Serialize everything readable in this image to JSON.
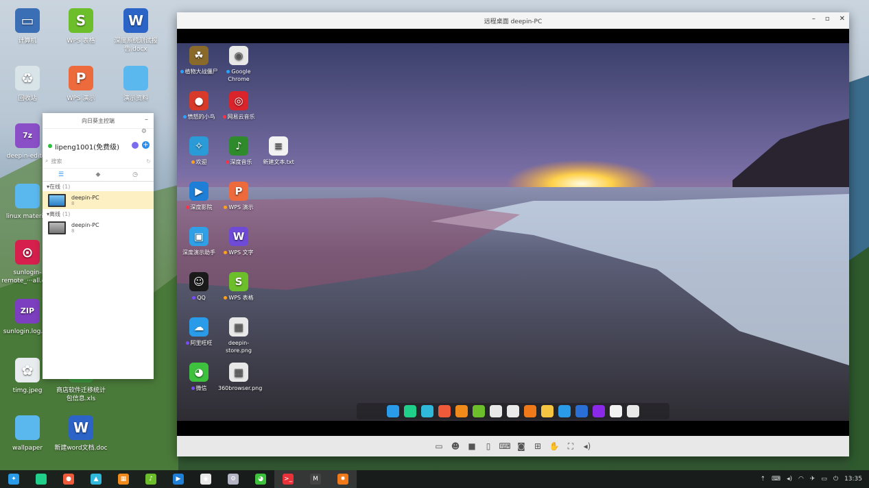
{
  "desktop_icons": [
    {
      "label": "计算机",
      "color": "#3b6fb5",
      "glyph": "▭"
    },
    {
      "label": "WPS 表格",
      "color": "#6cbf2a",
      "glyph": "S"
    },
    {
      "label": "深度系统测试报告.docx",
      "color": "#2b63c6",
      "glyph": "W"
    },
    {
      "label": "回收站",
      "color": "#d9e4e8",
      "glyph": "♻"
    },
    {
      "label": "WPS 演示",
      "color": "#ec6a3c",
      "glyph": "P"
    },
    {
      "label": "演示资料",
      "color": "#5bb8ee",
      "glyph": ""
    },
    {
      "label": "deepin-editor",
      "color": "#8a4fc7",
      "glyph": "7z"
    },
    {
      "label": "linux material",
      "color": "#5bb8ee",
      "glyph": ""
    },
    {
      "label": "sunlogin-remote_···all.deb",
      "color": "#d61f4d",
      "glyph": "⊙"
    },
    {
      "label": "sunlogin.log.zip",
      "color": "#7c3fbf",
      "glyph": "ZIP"
    },
    {
      "label": "timg.jpeg",
      "color": "#e8ecee",
      "glyph": "✿"
    },
    {
      "label": "商店软件迁移统计包信息.xls",
      "color": "#3d9a42",
      "glyph": "S"
    },
    {
      "label": "wallpaper",
      "color": "#5bb8ee",
      "glyph": ""
    },
    {
      "label": "新建word文档.doc",
      "color": "#2b63c6",
      "glyph": "W"
    }
  ],
  "remote_window": {
    "title": "远程桌面   deepin-PC",
    "buttons": {
      "minimize": "–",
      "maximize": "▫",
      "close": "✕"
    }
  },
  "remote_icons": [
    {
      "label": "植物大战僵尸",
      "dot": "#2aa3ff",
      "color": "#8a6a2a",
      "glyph": "☘"
    },
    {
      "label": "Google Chrome",
      "dot": "#2aa3ff",
      "color": "#e8e8e8",
      "glyph": "◉"
    },
    {
      "label": "愤怒的小鸟",
      "dot": "#2aa3ff",
      "color": "#d83a2a",
      "glyph": "●"
    },
    {
      "label": "网易云音乐",
      "dot": "#ff3344",
      "color": "#d8242a",
      "glyph": "◎"
    },
    {
      "label": "欢迎",
      "dot": "#ffa21a",
      "color": "#2a9bd6",
      "glyph": "✧"
    },
    {
      "label": "深度音乐",
      "dot": "#ff3344",
      "color": "#2e8a2a",
      "glyph": "♪"
    },
    {
      "label": "新建文本.txt",
      "dot": "",
      "color": "#f2f2f2",
      "glyph": "≡"
    },
    {
      "label": "深度影院",
      "dot": "#ff3344",
      "color": "#1f7fd6",
      "glyph": "▶"
    },
    {
      "label": "WPS 演示",
      "dot": "#ffa21a",
      "color": "#ec6a3c",
      "glyph": "P"
    },
    {
      "label": "深度演示助手",
      "dot": "",
      "color": "#2f9fe6",
      "glyph": "▣"
    },
    {
      "label": "WPS 文字",
      "dot": "#ffa21a",
      "color": "#6e4ad6",
      "glyph": "W"
    },
    {
      "label": "QQ",
      "dot": "#7a4cff",
      "color": "#1a1a1a",
      "glyph": "☺"
    },
    {
      "label": "WPS 表格",
      "dot": "#ffa21a",
      "color": "#6cbf2a",
      "glyph": "S"
    },
    {
      "label": "阿里旺旺",
      "dot": "#7a4cff",
      "color": "#2a9be8",
      "glyph": "☁"
    },
    {
      "label": "deepin-store.png",
      "dot": "",
      "color": "#e8e8e8",
      "glyph": "▦"
    },
    {
      "label": "微信",
      "dot": "#7a4cff",
      "color": "#3ec23e",
      "glyph": "◕"
    },
    {
      "label": "360browser.png",
      "dot": "",
      "color": "#e8e8e8",
      "glyph": "▦"
    }
  ],
  "remote_dock": [
    "#2a9be8",
    "#1fcf8a",
    "#2fb8d9",
    "#ef5a3a",
    "#f08a1a",
    "#6cbf2a",
    "#e8e8e8",
    "#eaeaea",
    "#f07a1a",
    "#f5c542",
    "#2a9be8",
    "#2a6fd6",
    "#8a2ae8",
    "#f2f2f2",
    "#e8e8e8"
  ],
  "remote_toolbar_icons": [
    "monitor-icon",
    "user-icon",
    "screen-icon",
    "file-icon",
    "keyboard-icon",
    "camera-icon",
    "layout-icon",
    "hand-icon",
    "fullscreen-icon",
    "volume-icon"
  ],
  "panel": {
    "title": "向日葵主控端",
    "minimize": "–",
    "settings": "⚙",
    "user": "lipeng1001(免费级)",
    "search_placeholder": "搜索",
    "groups": [
      {
        "name": "在线",
        "count": "(1)",
        "devices": [
          {
            "name": "deepin-PC",
            "sub": "8",
            "online": true
          }
        ]
      },
      {
        "name": "离线",
        "count": "(1)",
        "devices": [
          {
            "name": "deepin-PC",
            "sub": "8",
            "online": false
          }
        ]
      }
    ]
  },
  "taskbar_icons": [
    {
      "name": "launcher",
      "color": "#2a9be8",
      "glyph": "✦"
    },
    {
      "name": "file-manager",
      "color": "#1fcf8a",
      "glyph": ""
    },
    {
      "name": "screen-recorder",
      "color": "#ef5a3a",
      "glyph": "●"
    },
    {
      "name": "app-store",
      "color": "#2fb8d9",
      "glyph": "▲"
    },
    {
      "name": "archive",
      "color": "#f08a1a",
      "glyph": "▦"
    },
    {
      "name": "music",
      "color": "#6cbf2a",
      "glyph": "♪"
    },
    {
      "name": "video",
      "color": "#1f7fd6",
      "glyph": "▶"
    },
    {
      "name": "chrome",
      "color": "#e8e8e8",
      "glyph": "◉"
    },
    {
      "name": "settings",
      "color": "#b4b4c4",
      "glyph": "⚙"
    },
    {
      "name": "wechat",
      "color": "#3ec23e",
      "glyph": "◕"
    },
    {
      "name": "terminal",
      "color": "#e8323a",
      "glyph": ">_"
    },
    {
      "name": "monitor",
      "color": "#444",
      "glyph": "M"
    },
    {
      "name": "sunlogin",
      "color": "#f07a1a",
      "glyph": "✸"
    }
  ],
  "clock": "13:35"
}
